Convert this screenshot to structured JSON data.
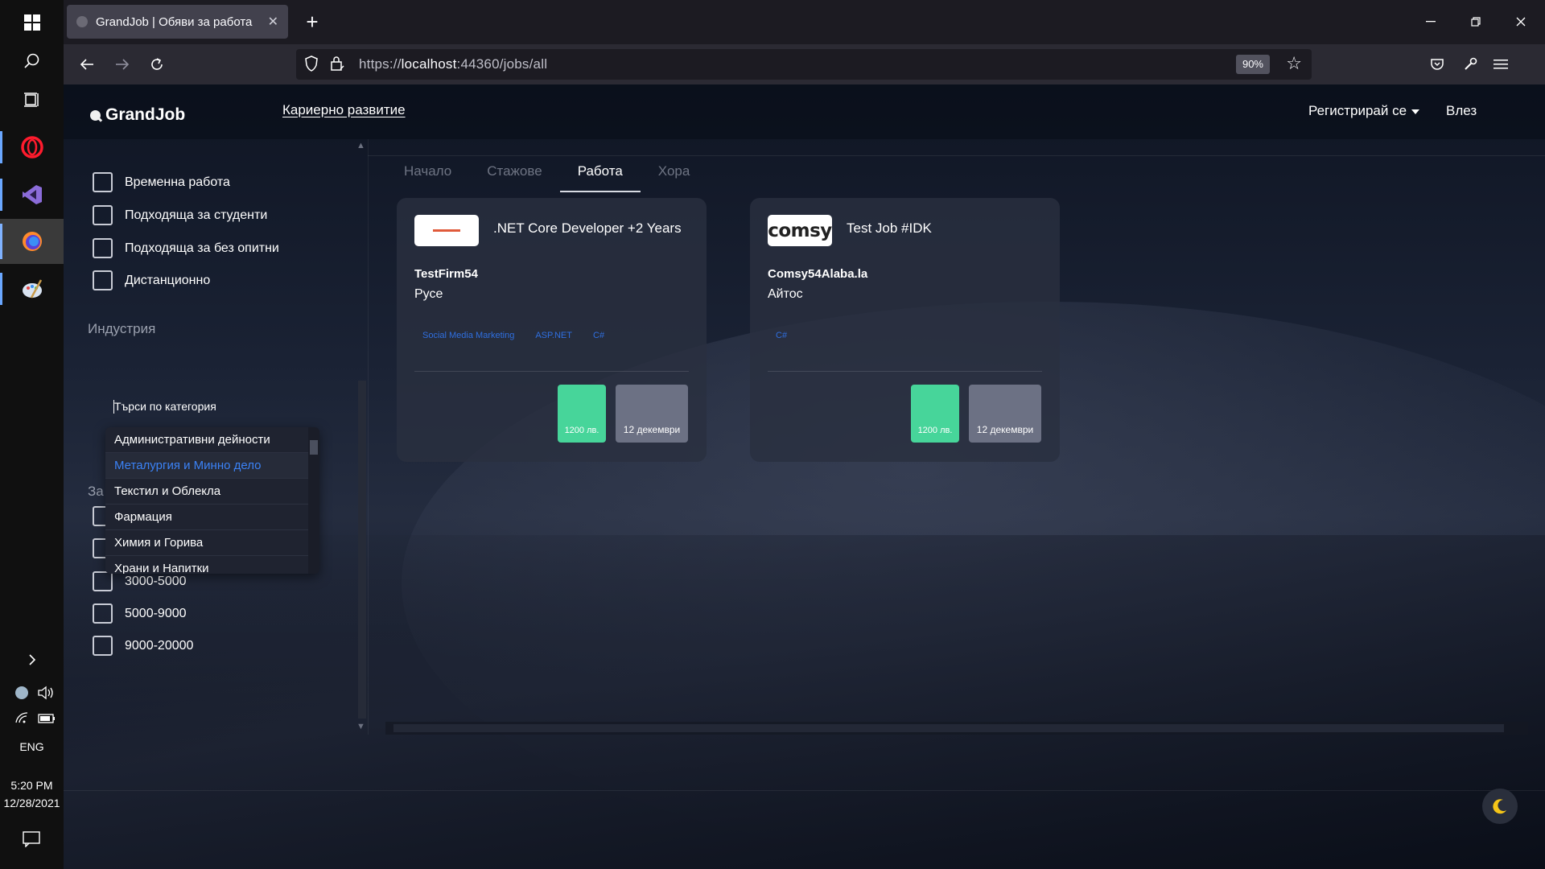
{
  "taskbar": {
    "apps": [
      "windows-start",
      "search",
      "task-view",
      "opera",
      "visual-studio",
      "firefox",
      "paint"
    ],
    "language": "ENG",
    "time": "5:20 PM",
    "date": "12/28/2021"
  },
  "browser": {
    "tab_title": "GrandJob | Обяви за работа",
    "url_scheme": "https://",
    "url_host": "localhost",
    "url_rest": ":44360/jobs/all",
    "zoom": "90%"
  },
  "site": {
    "brand": "GrandJob",
    "nav_career": "Кариерно развитие",
    "nav_register": "Регистрирай се",
    "nav_login": "Влез"
  },
  "filters": {
    "checkboxes_top": [
      "Временна работа",
      "Подходяща за студенти",
      "Подходяща за без опитни",
      "Дистанционно"
    ],
    "industry_title": "Индустрия",
    "search_placeholder": "Търси по категория",
    "dropdown_items": [
      "Административни дейности",
      "Металургия и Минно дело",
      "Текстил и Облекла",
      "Фармация",
      "Химия и Горива",
      "Храни и Напитки"
    ],
    "highlighted_item": "Металургия и Минно дело",
    "salary_partial_title": "За",
    "salary_hidden": "3000-5000",
    "salary_ranges": [
      "5000-9000",
      "9000-20000"
    ]
  },
  "main": {
    "tabs": [
      "Начало",
      "Стажове",
      "Работа",
      "Хора"
    ],
    "active_tab": "Работа",
    "jobs": [
      {
        "title": ".NET Core Developer +2 Years",
        "company": "TestFirm54",
        "city": "Русе",
        "tags": [
          "Social Media Marketing",
          "ASP.NET",
          "C#"
        ],
        "salary": "1200 лв.",
        "date": "12 декември",
        "logo": "testfirm-logo"
      },
      {
        "title": "Test Job #IDK",
        "company": "Comsy54Alaba.la",
        "city": "Айтос",
        "tags": [
          "C#"
        ],
        "salary": "1200 лв.",
        "date": "12 декември",
        "logo": "comsy-logo",
        "logo_text": "comsy"
      }
    ]
  },
  "colors": {
    "salary_bg": "#47d59a",
    "date_bg": "#6c7184",
    "tag_color": "#2f6fe0",
    "highlight": "#3b82f6"
  }
}
